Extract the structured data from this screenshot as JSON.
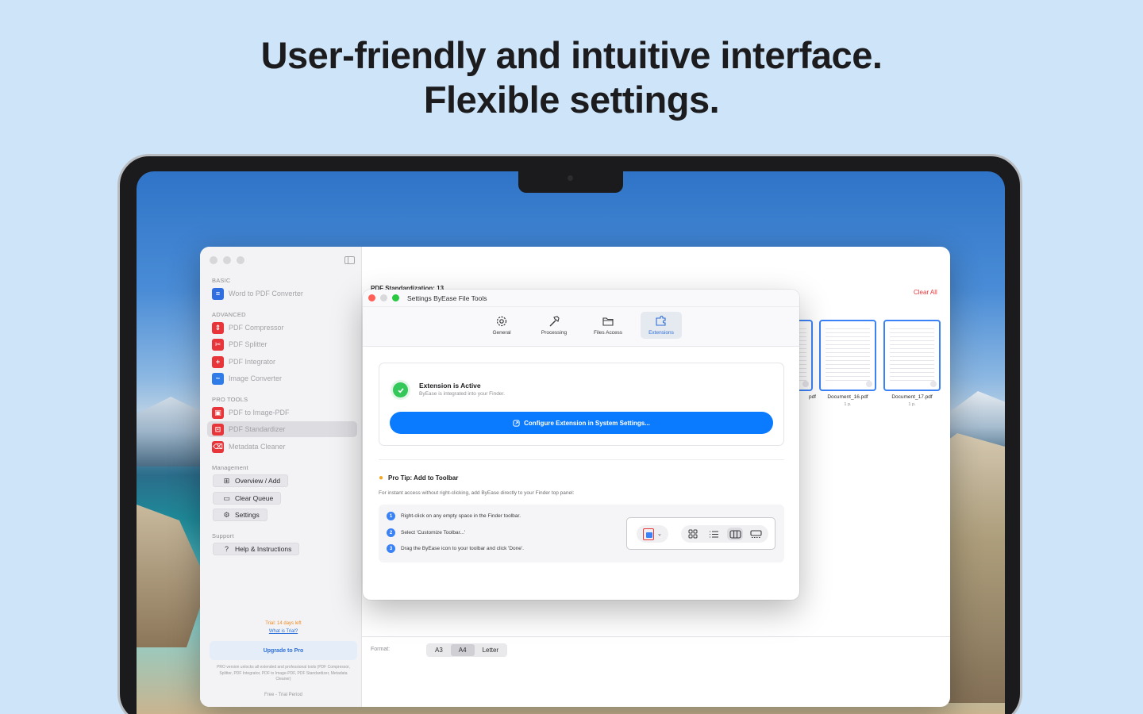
{
  "headline": {
    "line1": "User-friendly and intuitive interface.",
    "line2": "Flexible settings."
  },
  "sidebar": {
    "sections": {
      "basic": "BASIC",
      "advanced": "ADVANCED",
      "pro_tools": "PRO TOOLS",
      "management": "Management",
      "support": "Support"
    },
    "items": {
      "word_to_pdf": "Word to PDF Converter",
      "pdf_compressor": "PDF Compressor",
      "pdf_splitter": "PDF Splitter",
      "pdf_integrator": "PDF Integrator",
      "image_converter": "Image Converter",
      "pdf_to_image": "PDF to Image-PDF",
      "pdf_standardizer": "PDF Standardizer",
      "metadata_cleaner": "Metadata Cleaner"
    },
    "management": {
      "overview": "Overview / Add",
      "clear_queue": "Clear Queue",
      "settings": "Settings"
    },
    "support": {
      "help": "Help & Instructions"
    },
    "trial_text": "Trial: 14 days left",
    "what_is_trial": "What is Trial?",
    "upgrade_label": "Upgrade to Pro",
    "pro_description": "PRO version unlocks all extended and professional tools (PDF Compressor, Splitter, PDF Integrator, PDF to Image-PDF, PDF Standardizer, Metadata Cleaner)",
    "plan_label": "Free - Trial Period"
  },
  "main": {
    "title": "PDF Standardization: 13",
    "clear_all": "Clear All",
    "files": [
      {
        "name": "pdf",
        "pages": ""
      },
      {
        "name": "Document_16.pdf",
        "pages": "1 p."
      },
      {
        "name": "Document_17.pdf",
        "pages": "1 p."
      }
    ],
    "format_label": "Format:",
    "format_options": [
      "A3",
      "A4",
      "Letter"
    ],
    "format_selected": "A4"
  },
  "settings": {
    "title": "Settings ByEase File Tools",
    "tabs": {
      "general": "General",
      "processing": "Processing",
      "files_access": "Files Access",
      "extensions": "Extensions"
    },
    "active_tab": "Extensions",
    "extension_title": "Extension is Active",
    "extension_subtitle": "ByEase is integrated into your Finder.",
    "configure_button": "Configure Extension in System Settings...",
    "pro_tip_title": "Pro Tip: Add to Toolbar",
    "pro_tip_subtitle": "For instant access without right-clicking, add ByEase directly to your Finder top panel:",
    "steps": [
      {
        "num": "1",
        "text": "Right-click on any empty space in the Finder toolbar."
      },
      {
        "num": "2",
        "text": "Select 'Customize Toolbar...'"
      },
      {
        "num": "3",
        "text": "Drag the ByEase icon to your toolbar and click 'Done'."
      }
    ]
  },
  "colors": {
    "background": "#cde4f9",
    "accent": "#0a7aff",
    "success": "#34c759",
    "danger": "#e8353a",
    "trial": "#f08a24"
  }
}
